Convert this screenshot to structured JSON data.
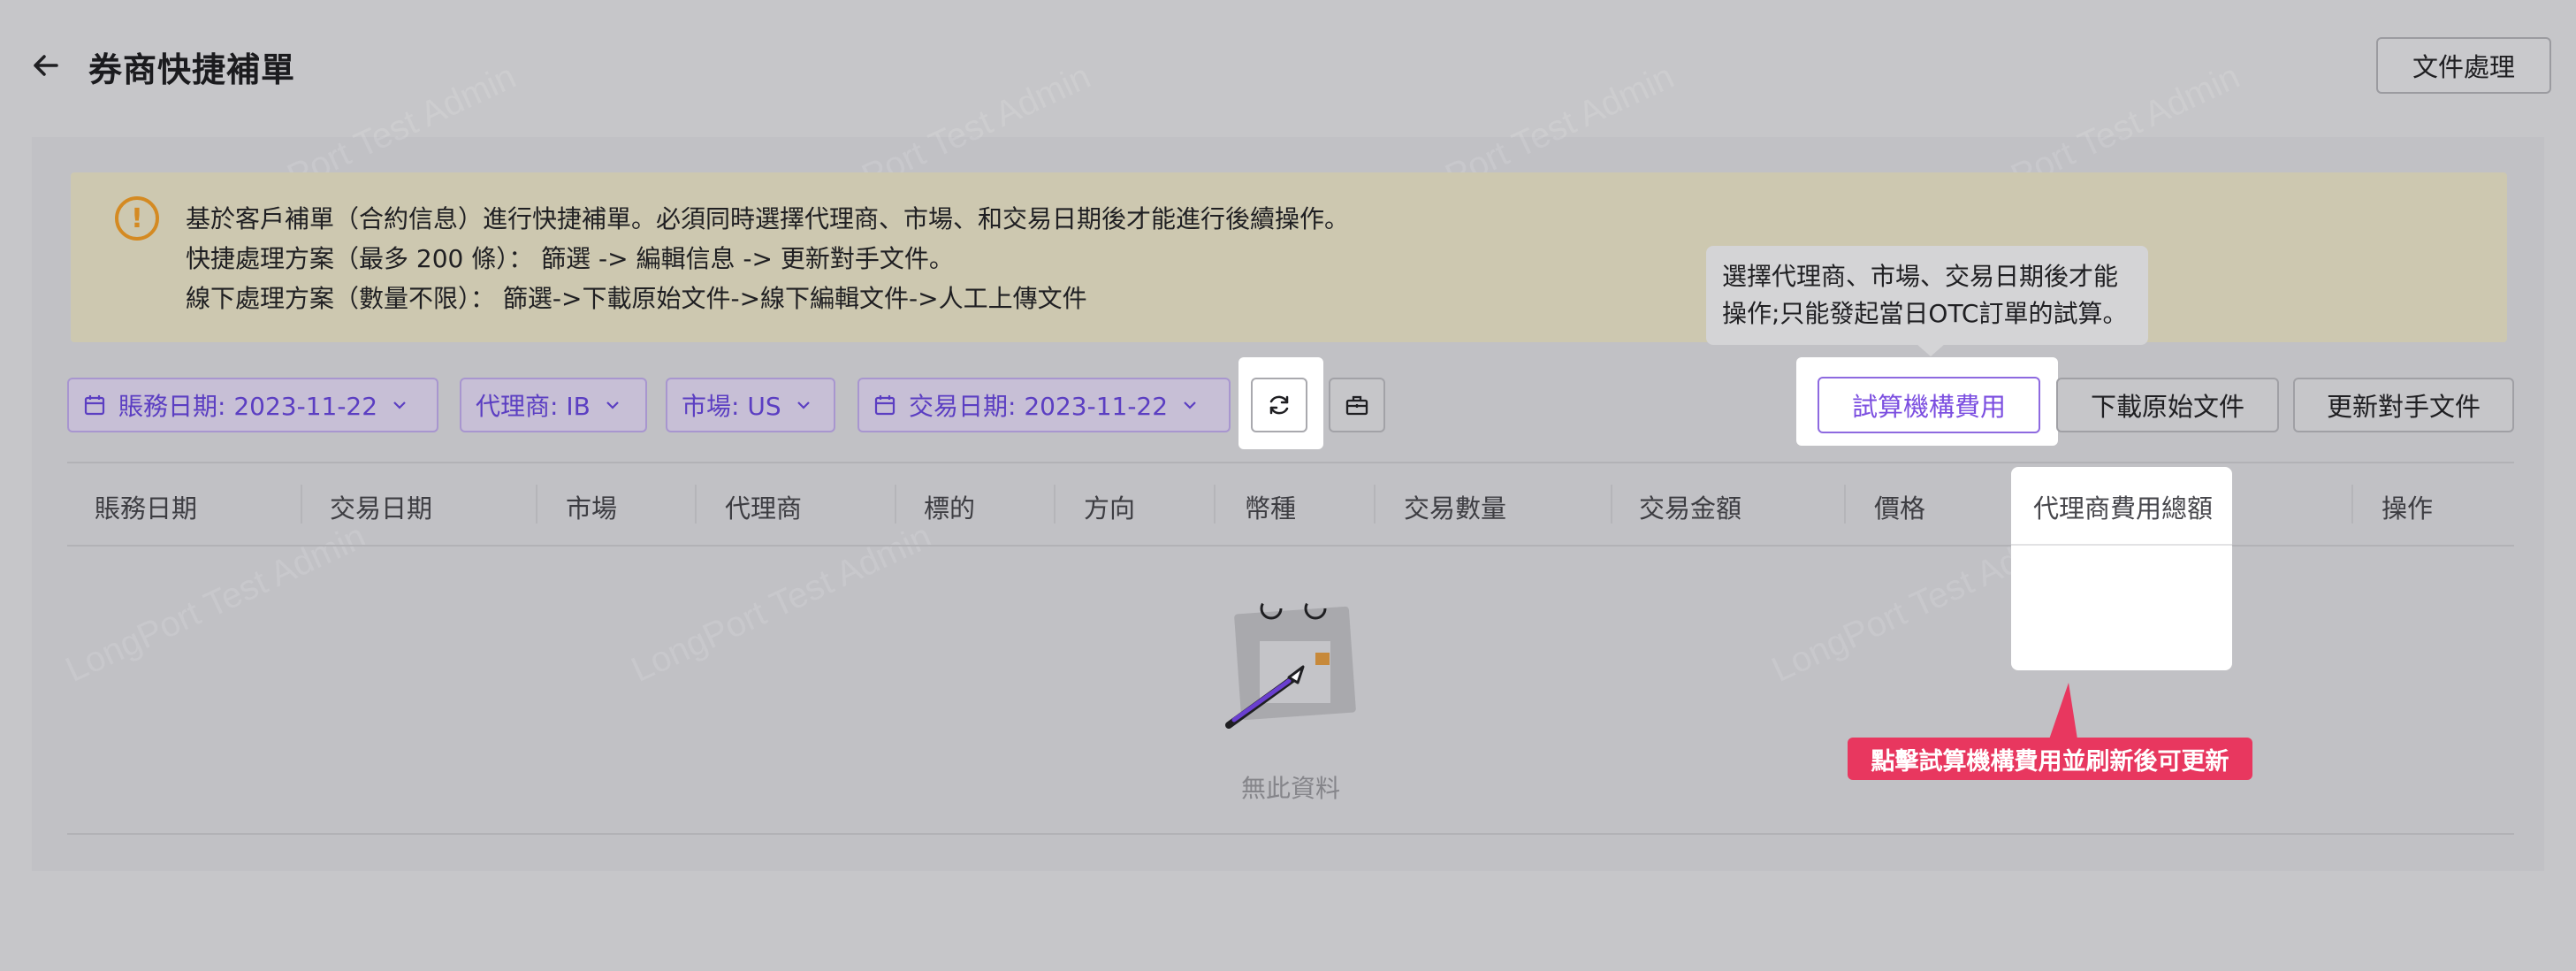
{
  "header": {
    "title": "券商快捷補單",
    "doc_button": "文件處理"
  },
  "notice": {
    "icon": "exclamation-circle-icon",
    "lines": [
      "基於客戶補單（合約信息）進行快捷補單。必須同時選擇代理商、市場、和交易日期後才能進行後續操作。",
      "快捷處理方案（最多 200 條）： 篩選 -> 編輯信息 -> 更新對手文件。",
      "線下處理方案（數量不限）： 篩選->下載原始文件->線下編輯文件->人工上傳文件"
    ]
  },
  "filters": {
    "account_date": "賬務日期: 2023-11-22",
    "agent": "代理商: IB",
    "market": "市場: US",
    "trade_date": "交易日期: 2023-11-22"
  },
  "tooltip": {
    "line1": "選擇代理商、市場、交易日期後才能",
    "line2": "操作;只能發起當日OTC訂單的試算。"
  },
  "actions": {
    "calc_fee": "試算機構費用",
    "download_original": "下載原始文件",
    "update_counterparty": "更新對手文件"
  },
  "table": {
    "columns": [
      "賬務日期",
      "交易日期",
      "市場",
      "代理商",
      "標的",
      "方向",
      "幣種",
      "交易數量",
      "交易金額",
      "價格",
      "代理商費用總額",
      "操作"
    ],
    "empty_text": "無此資料"
  },
  "callout": {
    "text": "點擊試算機構費用並刷新後可更新"
  },
  "watermark": "LongPort Test Admin",
  "colors": {
    "accent": "#7b4ee0",
    "callout": "#e8375f",
    "warning": "#d48a22"
  }
}
